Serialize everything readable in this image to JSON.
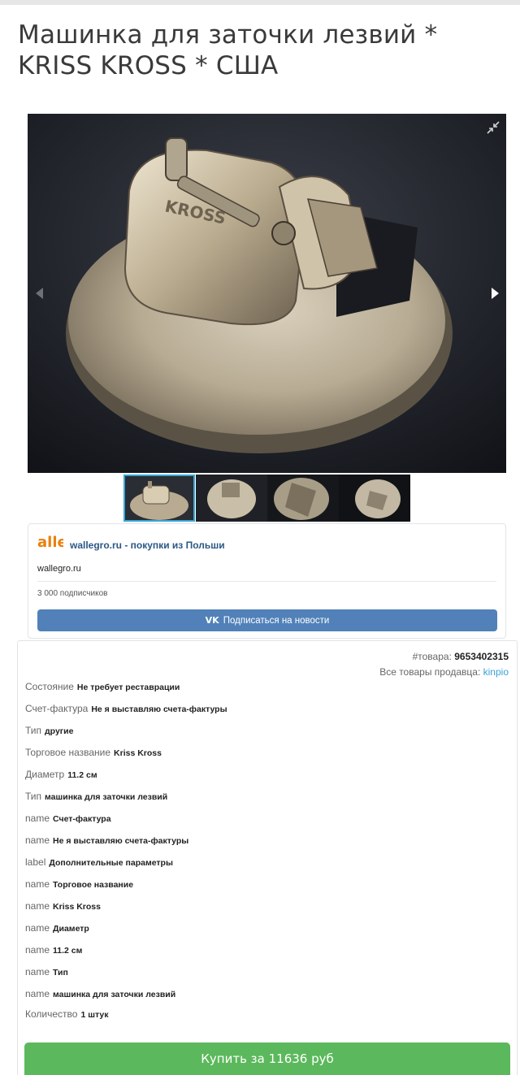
{
  "product": {
    "title": "Машинка для заточки лезвий * KRISS KROSS * США"
  },
  "gallery": {
    "photo_brand": "KROSS",
    "thumbnail_count": 4,
    "active_index": 0
  },
  "vk_widget": {
    "logo_text": "alle",
    "group_name": "wallegro.ru - покупки из Польши",
    "domain": "wallegro.ru",
    "subscribers": "3 000 подписчиков",
    "vk_glyph": "VK",
    "subscribe_label": "Подписаться на новости"
  },
  "details": {
    "item_no_label": "#товара:",
    "item_no": "9653402315",
    "seller_label": "Все товары продавца:",
    "seller": "kinpio",
    "properties": [
      {
        "name": "Состояние",
        "value": "Не требует реставрации"
      },
      {
        "name": "Счет-фактура",
        "value": "Не я выставляю счета-фактуры"
      },
      {
        "name": "Тип",
        "value": "другие"
      },
      {
        "name": "Торговое название",
        "value": "Kriss Kross"
      },
      {
        "name": "Диаметр",
        "value": "11.2 см"
      },
      {
        "name": "Тип",
        "value": "машинка для заточки лезвий"
      },
      {
        "name": "name",
        "value": "Счет-фактура"
      },
      {
        "name": "name",
        "value": "Не я выставляю счета-фактуры"
      },
      {
        "name": "label",
        "value": "Дополнительные параметры"
      },
      {
        "name": "name",
        "value": "Торговое название"
      },
      {
        "name": "name",
        "value": "Kriss Kross"
      },
      {
        "name": "name",
        "value": "Диаметр"
      },
      {
        "name": "name",
        "value": "11.2 см"
      },
      {
        "name": "name",
        "value": "Тип"
      },
      {
        "name": "name",
        "value": "машинка для заточки лезвий"
      },
      {
        "name": "Количество",
        "value": "1 штук"
      }
    ],
    "buy_label": "Купить за 11636 руб"
  },
  "colors": {
    "link": "#3aa0d8",
    "vk_blue": "#5181b8",
    "buy_green": "#5cb85c",
    "thumb_active": "#36a6d6"
  },
  "icons": [
    "expand-icon",
    "prev-arrow-icon",
    "next-arrow-icon",
    "vk-icon"
  ]
}
